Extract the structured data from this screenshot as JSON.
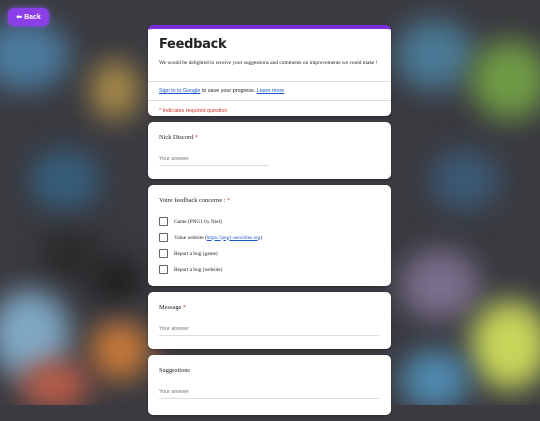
{
  "back_button": {
    "icon": "left-arrow-icon",
    "label": "Back"
  },
  "form": {
    "title": "Feedback",
    "description": "We would be delighted to receive your suggestions and comments on improvements we could make !",
    "signin_link": "Sign in to Google",
    "signin_text": "to save your progress.",
    "learn_more": "Learn more",
    "required_note": "* Indicates required question",
    "accent_color": "#7a2cd8"
  },
  "questions": {
    "nick": {
      "label": "Nick Discord",
      "placeholder": "Your answer",
      "required": "*"
    },
    "concern": {
      "label": "Votre feedback concerne :",
      "required": "*",
      "options": {
        "game": "Game (PNG1 by Niel)",
        "value_site_prefix": "Value website (",
        "value_site_link": "https://png1.neocities.org",
        "value_site_suffix": ")",
        "bug_game": "Report a bug (game)",
        "bug_site": "Report a bug (website)"
      }
    },
    "message": {
      "label": "Message",
      "placeholder": "Your answer",
      "required": "*"
    },
    "suggestions": {
      "label": "Suggestions",
      "placeholder": "Your answer"
    }
  }
}
